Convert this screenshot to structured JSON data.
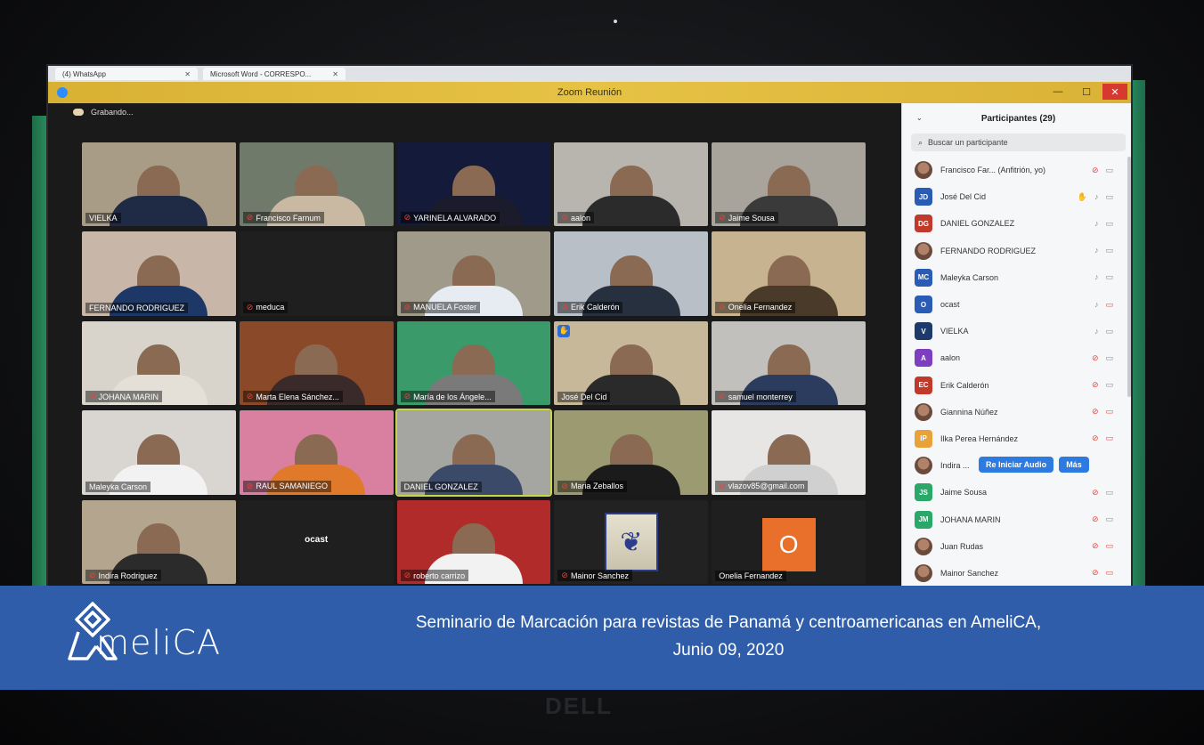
{
  "browser_tabs": [
    {
      "label": "(4) WhatsApp"
    },
    {
      "label": "Microsoft Word - CORRESPO..."
    }
  ],
  "window": {
    "title": "Zoom Reunión"
  },
  "status": {
    "recording": "Grabando..."
  },
  "tiles": [
    {
      "name": "VIELKA",
      "muted": false,
      "bg": "#a99c86",
      "shirt": "#1f2a44"
    },
    {
      "name": "Francisco Farnum",
      "muted": true,
      "bg": "#6f7a6a",
      "shirt": "#c9b9a2"
    },
    {
      "name": "YARINELA ALVARADO",
      "muted": true,
      "bg": "#141a3a",
      "shirt": "#1b1b2b"
    },
    {
      "name": "aalon",
      "muted": true,
      "bg": "#b8b5ae",
      "shirt": "#2b2b2b"
    },
    {
      "name": "Jaime Sousa",
      "muted": true,
      "bg": "#a8a49c",
      "shirt": "#3a3a3a"
    },
    {
      "name": "FERNANDO RODRIGUEZ",
      "muted": false,
      "bg": "#c8b6a8",
      "shirt": "#1d3766"
    },
    {
      "name": "meduca",
      "muted": true,
      "bg": "#1f1f1f",
      "shirt": "",
      "empty": true
    },
    {
      "name": "MANUELA Foster",
      "muted": true,
      "bg": "#a09a8a",
      "shirt": "#e6ecf2"
    },
    {
      "name": "Erik Calderón",
      "muted": true,
      "bg": "#b9bfc6",
      "shirt": "#26303e"
    },
    {
      "name": "Onelia Fernandez",
      "muted": true,
      "bg": "#c7b38f",
      "shirt": "#4a3a2a"
    },
    {
      "name": "JOHANA MARIN",
      "muted": true,
      "bg": "#d8d4cc",
      "shirt": "#e4e0d8"
    },
    {
      "name": "Marta Elena Sánchez...",
      "muted": true,
      "bg": "#8a4a2a",
      "shirt": "#3a2a2a"
    },
    {
      "name": "María de los Ángele...",
      "muted": true,
      "bg": "#3a9a6a",
      "shirt": "#7a7a7a"
    },
    {
      "name": "José Del Cid",
      "muted": false,
      "hand": true,
      "bg": "#c7b89a",
      "shirt": "#2a2a2a"
    },
    {
      "name": "samuel monterrey",
      "muted": true,
      "bg": "#c2c0bd",
      "shirt": "#2b3c5e"
    },
    {
      "name": "Maleyka Carson",
      "muted": false,
      "bg": "#d9d6d2",
      "shirt": "#f2f2f2"
    },
    {
      "name": "RAUL SAMANIEGO",
      "muted": true,
      "bg": "#d97fa0",
      "shirt": "#e07a2a"
    },
    {
      "name": "DANIEL GONZALEZ",
      "muted": false,
      "bg": "#a5a6a2",
      "shirt": "#3c4a6a",
      "selected": true
    },
    {
      "name": "Maria Zeballos",
      "muted": true,
      "bg": "#9c9a70",
      "shirt": "#1b1b1b"
    },
    {
      "name": "vlazov85@gmail.com",
      "muted": true,
      "bg": "#e8e6e4",
      "shirt": "#d0d0d0"
    },
    {
      "name": "Indira Rodriguez",
      "muted": true,
      "bg": "#b3a58e",
      "shirt": "#2b2b2b"
    },
    {
      "name": "ocast",
      "muted": false,
      "bg": "#1f1f1f",
      "shirt": "",
      "text_center": "ocast"
    },
    {
      "name": "roberto carrizo",
      "muted": true,
      "bg": "#b12b2b",
      "shirt": "#f2f2f2"
    },
    {
      "name": "Mainor Sanchez",
      "muted": true,
      "bg": "#222",
      "shirt": "",
      "crest": true
    },
    {
      "name": "Onelia Fernandez",
      "muted": false,
      "bg": "#1f1f1f",
      "shirt": "",
      "avatar_letter": "O"
    }
  ],
  "panel": {
    "title": "Participantes (29)",
    "search_placeholder": "Buscar un participante",
    "participants": [
      {
        "initials": "",
        "photo": true,
        "name": "Francisco Far...   (Anfitrión, yo)",
        "color": "",
        "mic": "muted",
        "video": "on"
      },
      {
        "initials": "JD",
        "name": "José Del Cid",
        "color": "#2a5bb5",
        "mic": "on",
        "hand": true,
        "video": "on"
      },
      {
        "initials": "DG",
        "name": "DANIEL GONZALEZ",
        "color": "#c0392b",
        "mic": "on",
        "video": "on"
      },
      {
        "initials": "",
        "photo": true,
        "name": "FERNANDO RODRIGUEZ",
        "color": "",
        "mic": "on",
        "video": "on"
      },
      {
        "initials": "MC",
        "name": "Maleyka Carson",
        "color": "#2a5bb5",
        "mic": "on",
        "video": "on"
      },
      {
        "initials": "O",
        "name": "ocast",
        "color": "#2a5bb5",
        "mic": "on",
        "video": "off"
      },
      {
        "initials": "V",
        "name": "VIELKA",
        "color": "#1e3a6a",
        "mic": "on",
        "video": "on"
      },
      {
        "initials": "A",
        "name": "aalon",
        "color": "#7b3fbf",
        "mic": "muted",
        "video": "on"
      },
      {
        "initials": "EC",
        "name": "Erik Calderón",
        "color": "#c0392b",
        "mic": "muted",
        "video": "on"
      },
      {
        "initials": "",
        "photo": true,
        "name": "Giannina Núñez",
        "color": "",
        "mic": "muted",
        "video": "off"
      },
      {
        "initials": "IP",
        "name": "Ilka Perea Hernández",
        "color": "#e8a23a",
        "mic": "muted",
        "video": "off"
      },
      {
        "initials": "",
        "photo": true,
        "name": "Indira ...",
        "color": "",
        "mic": "",
        "video": "",
        "hover": true
      },
      {
        "initials": "JS",
        "name": "Jaime Sousa",
        "color": "#2aa86a",
        "mic": "muted",
        "video": "on"
      },
      {
        "initials": "JM",
        "name": "JOHANA MARIN",
        "color": "#2aa86a",
        "mic": "muted",
        "video": "on"
      },
      {
        "initials": "",
        "photo": true,
        "name": "Juan Rudas",
        "color": "",
        "mic": "muted",
        "video": "off"
      },
      {
        "initials": "",
        "photo": true,
        "name": "Mainor Sanchez",
        "color": "",
        "mic": "muted",
        "video": "off"
      }
    ],
    "hover_actions": {
      "primary": "Re Iniciar Audio",
      "more": "Más"
    }
  },
  "banner": {
    "logo_text": "meliCA",
    "caption_line1": "Seminario de Marcación para revistas de Panamá y centroamericanas en AmeliCA,",
    "caption_line2": "Junio 09, 2020"
  },
  "bezel": {
    "brand": "DELL"
  },
  "colors": {
    "banner": "#2f5da9",
    "zoom_title": "#e6c245",
    "muted_mic": "#e8453c",
    "zoom_blue": "#2d7be0"
  }
}
